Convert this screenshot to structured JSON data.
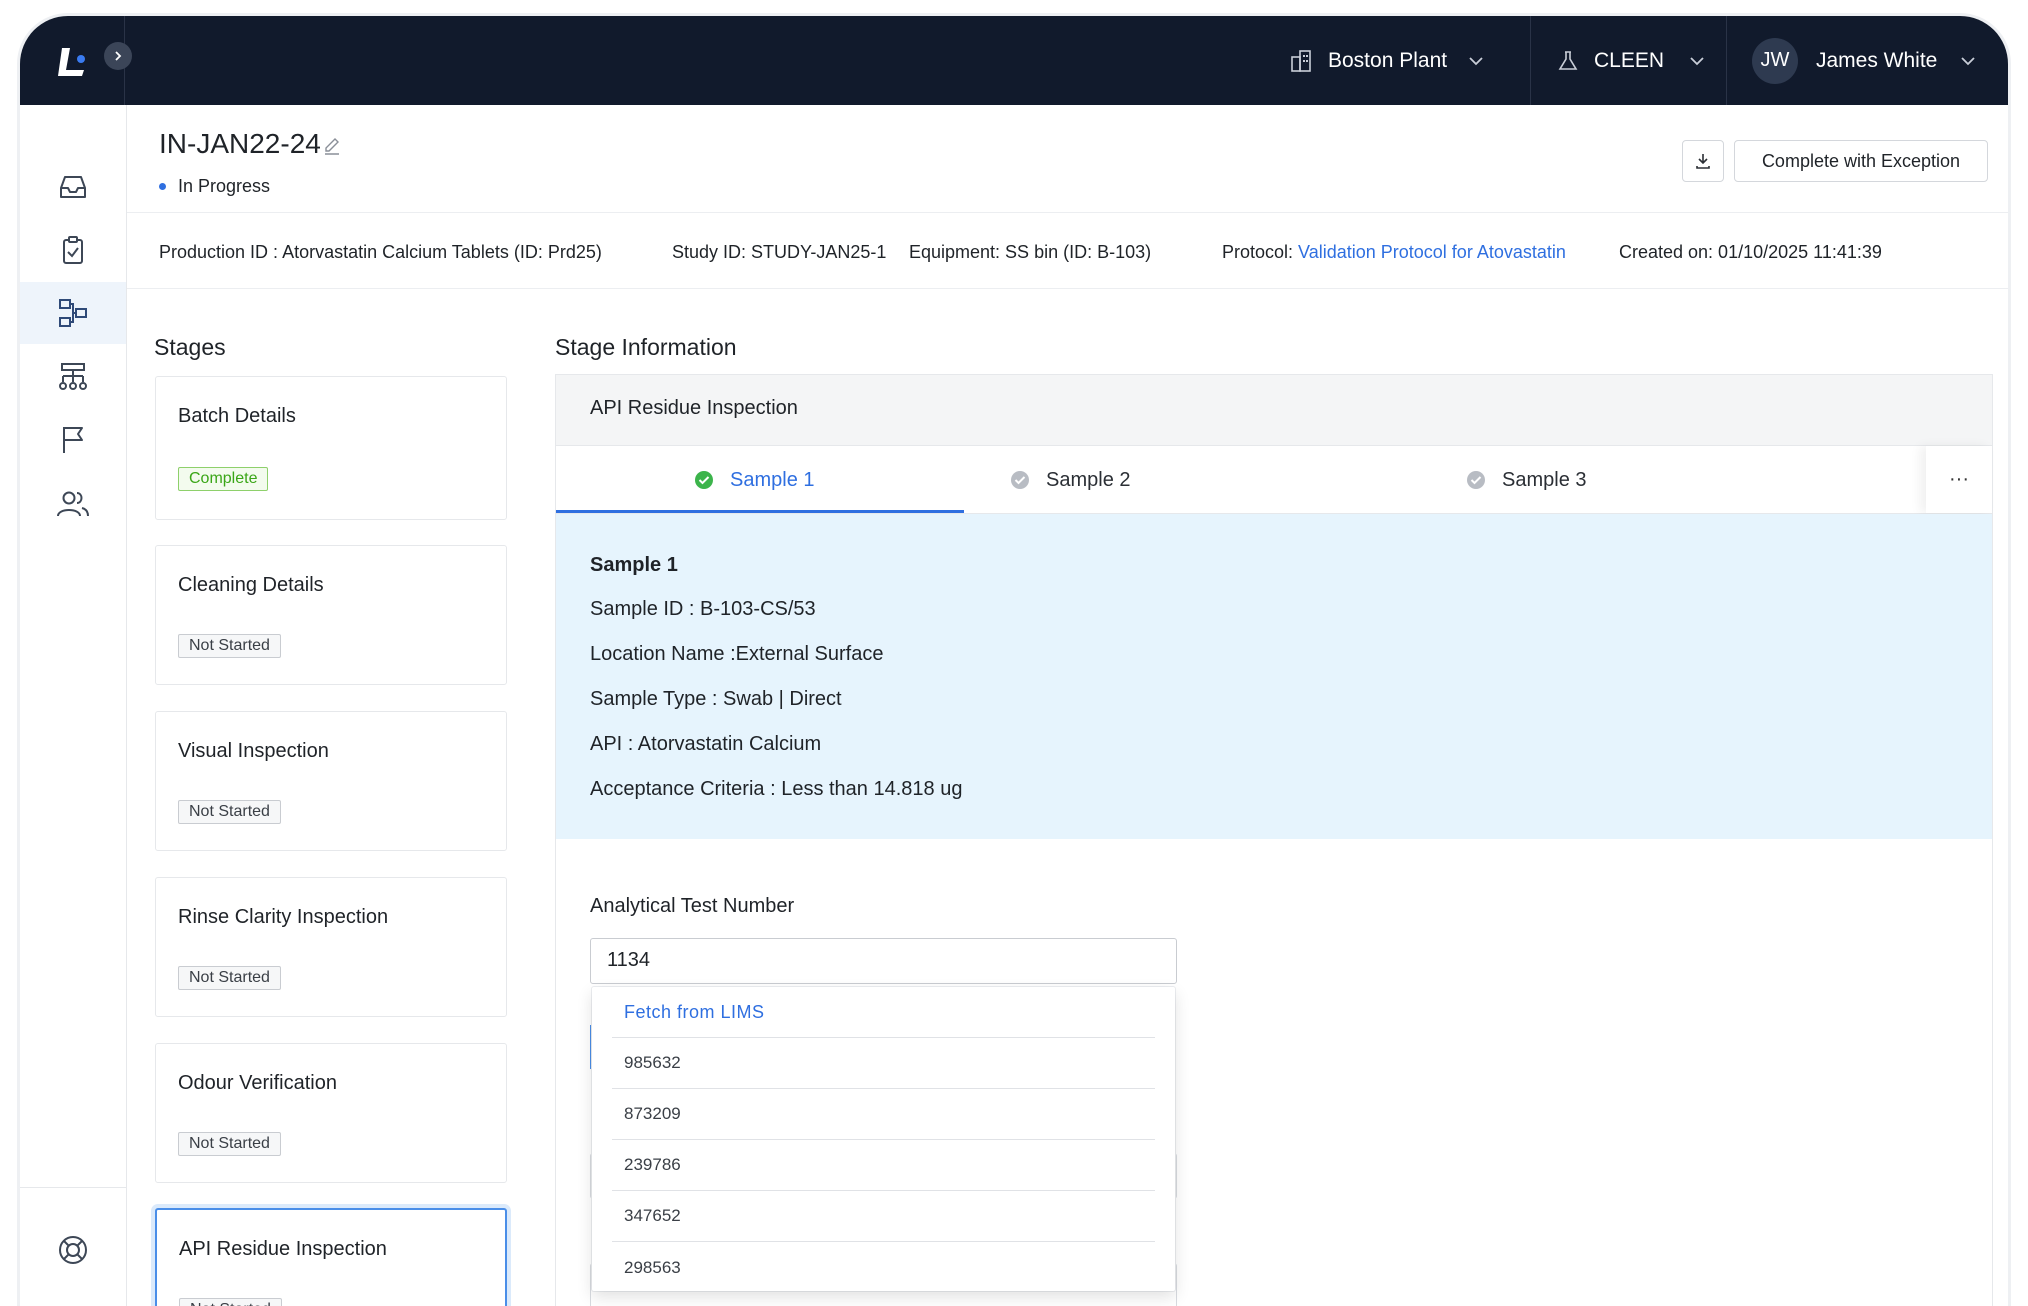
{
  "topbar": {
    "plant": "Boston Plant",
    "module": "CLEEN",
    "user_initials": "JW",
    "user_name": "James White"
  },
  "sidebar": {
    "items": [
      {
        "icon": "inbox-icon"
      },
      {
        "icon": "clipboard-check-icon"
      },
      {
        "icon": "workflow-icon",
        "active": true
      },
      {
        "icon": "hierarchy-icon"
      },
      {
        "icon": "flag-icon"
      },
      {
        "icon": "users-icon"
      }
    ],
    "bottom_icon": "help-lifebuoy-icon"
  },
  "header": {
    "title": "IN-JAN22-24",
    "status": "In Progress",
    "complete_exception_label": "Complete with Exception"
  },
  "meta": {
    "production": "Production ID : Atorvastatin Calcium Tablets (ID: Prd25)",
    "study": "Study ID: STUDY-JAN25-1",
    "equipment": "Equipment: SS bin (ID: B-103)",
    "protocol_label": "Protocol: ",
    "protocol_link": "Validation Protocol for Atovastatin",
    "created": "Created on: 01/10/2025 11:41:39"
  },
  "stages": {
    "heading": "Stages",
    "items": [
      {
        "name": "Batch Details",
        "status": "Complete"
      },
      {
        "name": "Cleaning Details",
        "status": "Not Started"
      },
      {
        "name": "Visual Inspection",
        "status": "Not Started"
      },
      {
        "name": "Rinse Clarity Inspection",
        "status": "Not Started"
      },
      {
        "name": "Odour Verification",
        "status": "Not Started"
      },
      {
        "name": "API Residue Inspection",
        "status": "Not Started"
      }
    ]
  },
  "stage_info": {
    "heading": "Stage Information",
    "panel_title": "API Residue Inspection",
    "tabs": [
      {
        "label": "Sample 1",
        "state": "done"
      },
      {
        "label": "Sample 2",
        "state": "pending"
      },
      {
        "label": "Sample 3",
        "state": "pending"
      }
    ],
    "more_label": "···",
    "sample": {
      "title": "Sample 1",
      "id": "Sample ID : B-103-CS/53",
      "location": "Location Name :External Surface",
      "type": "Sample Type : Swab | Direct",
      "api": "API : Atorvastatin Calcium",
      "criteria": "Acceptance Criteria : Less than 14.818 ug"
    },
    "field_label": "Analytical Test Number",
    "field_value": "1134",
    "dropdown": {
      "fetch_label": "Fetch from LIMS",
      "options": [
        "985632",
        "873209",
        "239786",
        "347652",
        "298563"
      ]
    }
  }
}
